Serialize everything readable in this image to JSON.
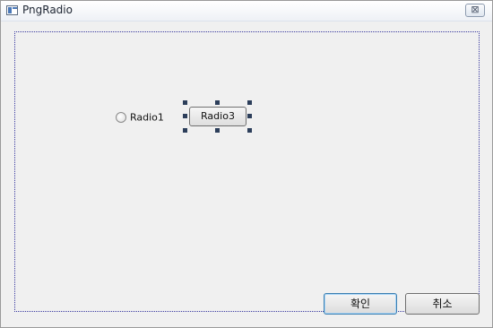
{
  "window": {
    "title": "PngRadio",
    "close_symbol": "⊠"
  },
  "controls": {
    "radio1_label": "Radio1",
    "radio3_label": "Radio3"
  },
  "buttons": {
    "ok_label": "확인",
    "cancel_label": "취소"
  },
  "icons": {
    "app": "dialog-app-icon",
    "close": "close-icon",
    "radio": "radio-circle-icon",
    "selection": "selection-handle-icon"
  },
  "colors": {
    "dialog_bg": "#f0f0f0",
    "selection_handle": "#2c3e5a",
    "client_border": "#3a3aa0",
    "default_button_border": "#3c7fb1"
  }
}
